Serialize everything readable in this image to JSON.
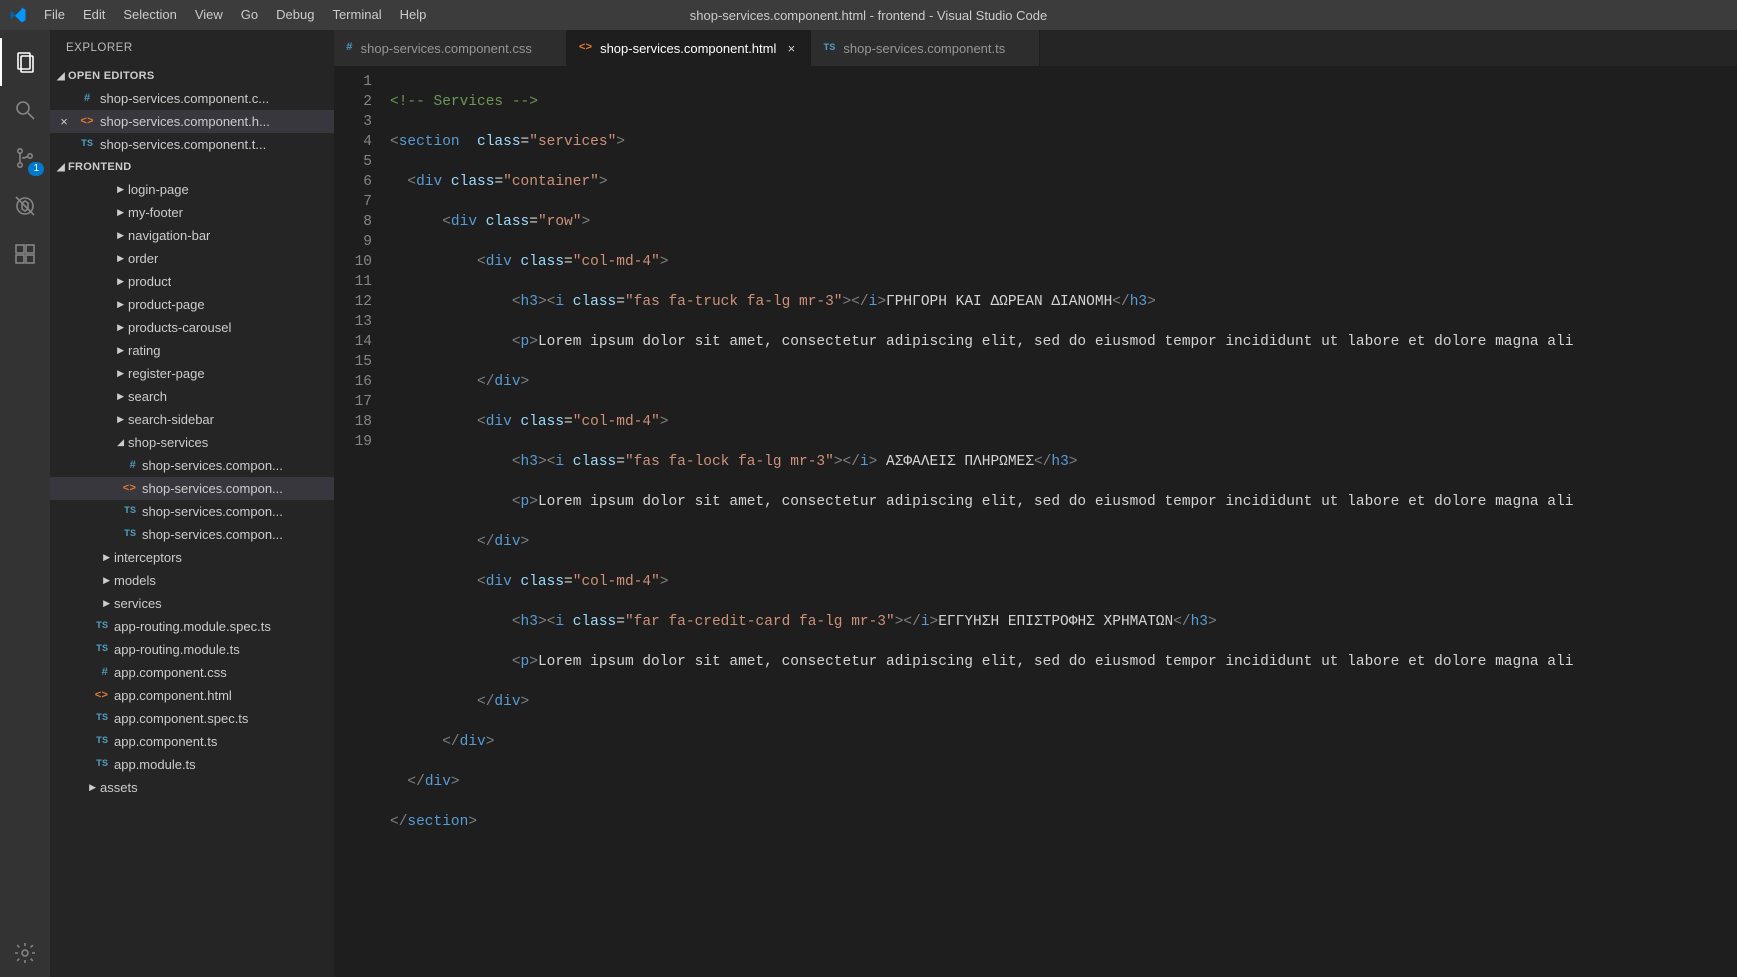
{
  "titlebar": {
    "title": "shop-services.component.html - frontend - Visual Studio Code",
    "menu": [
      "File",
      "Edit",
      "Selection",
      "View",
      "Go",
      "Debug",
      "Terminal",
      "Help"
    ]
  },
  "activitybar": {
    "scm_badge": "1"
  },
  "sidebar": {
    "title": "EXPLORER",
    "open_editors_label": "OPEN EDITORS",
    "open_editors": [
      {
        "name": "shop-services.component.c...",
        "icon": "css",
        "active": false,
        "close": " "
      },
      {
        "name": "shop-services.component.h...",
        "icon": "html",
        "active": true,
        "close": "×"
      },
      {
        "name": "shop-services.component.t...",
        "icon": "ts",
        "active": false,
        "close": " "
      }
    ],
    "workspace_label": "FRONTEND",
    "tree": [
      {
        "type": "folder",
        "depth": 3,
        "open": false,
        "name": "login-page"
      },
      {
        "type": "folder",
        "depth": 3,
        "open": false,
        "name": "my-footer"
      },
      {
        "type": "folder",
        "depth": 3,
        "open": false,
        "name": "navigation-bar"
      },
      {
        "type": "folder",
        "depth": 3,
        "open": false,
        "name": "order"
      },
      {
        "type": "folder",
        "depth": 3,
        "open": false,
        "name": "product"
      },
      {
        "type": "folder",
        "depth": 3,
        "open": false,
        "name": "product-page"
      },
      {
        "type": "folder",
        "depth": 3,
        "open": false,
        "name": "products-carousel"
      },
      {
        "type": "folder",
        "depth": 3,
        "open": false,
        "name": "rating"
      },
      {
        "type": "folder",
        "depth": 3,
        "open": false,
        "name": "register-page"
      },
      {
        "type": "folder",
        "depth": 3,
        "open": false,
        "name": "search"
      },
      {
        "type": "folder",
        "depth": 3,
        "open": false,
        "name": "search-sidebar"
      },
      {
        "type": "folder",
        "depth": 3,
        "open": true,
        "name": "shop-services"
      },
      {
        "type": "file",
        "depth": 4,
        "icon": "css",
        "name": "shop-services.compon..."
      },
      {
        "type": "file",
        "depth": 4,
        "icon": "html",
        "name": "shop-services.compon...",
        "selected": true
      },
      {
        "type": "file",
        "depth": 4,
        "icon": "ts",
        "name": "shop-services.compon..."
      },
      {
        "type": "file",
        "depth": 4,
        "icon": "ts",
        "name": "shop-services.compon..."
      },
      {
        "type": "folder",
        "depth": 2,
        "open": false,
        "name": "interceptors"
      },
      {
        "type": "folder",
        "depth": 2,
        "open": false,
        "name": "models"
      },
      {
        "type": "folder",
        "depth": 2,
        "open": false,
        "name": "services"
      },
      {
        "type": "file",
        "depth": 2,
        "icon": "ts",
        "name": "app-routing.module.spec.ts"
      },
      {
        "type": "file",
        "depth": 2,
        "icon": "ts",
        "name": "app-routing.module.ts"
      },
      {
        "type": "file",
        "depth": 2,
        "icon": "css",
        "name": "app.component.css"
      },
      {
        "type": "file",
        "depth": 2,
        "icon": "html",
        "name": "app.component.html"
      },
      {
        "type": "file",
        "depth": 2,
        "icon": "ts",
        "name": "app.component.spec.ts"
      },
      {
        "type": "file",
        "depth": 2,
        "icon": "ts",
        "name": "app.component.ts"
      },
      {
        "type": "file",
        "depth": 2,
        "icon": "ts",
        "name": "app.module.ts"
      },
      {
        "type": "folder",
        "depth": 1,
        "open": false,
        "name": "assets"
      }
    ]
  },
  "tabs": [
    {
      "name": "shop-services.component.css",
      "icon": "css",
      "active": false
    },
    {
      "name": "shop-services.component.html",
      "icon": "html",
      "active": true
    },
    {
      "name": "shop-services.component.ts",
      "icon": "ts",
      "active": false
    }
  ],
  "code": {
    "line_numbers": [
      "1",
      "2",
      "3",
      "4",
      "5",
      "6",
      "7",
      "8",
      "9",
      "10",
      "11",
      "12",
      "13",
      "14",
      "15",
      "16",
      "17",
      "18",
      "19"
    ],
    "lines": {
      "l1": "<!-- Services -->",
      "l2_tag": "section",
      "l2_attr": "class",
      "l2_val": "\"services\"",
      "l3_tag": "div",
      "l3_attr": "class",
      "l3_val": "\"container\"",
      "l4_tag": "div",
      "l4_attr": "class",
      "l4_val": "\"row\"",
      "l5_tag": "div",
      "l5_attr": "class",
      "l5_val": "\"col-md-4\"",
      "l6_h3": "h3",
      "l6_i": "i",
      "l6_attr": "class",
      "l6_val": "\"fas fa-truck fa-lg mr-3\"",
      "l6_text": "ΓΡΗΓΟΡΗ ΚΑΙ ΔΩΡΕΑΝ ΔΙΑΝΟΜΗ",
      "l7_p": "p",
      "l7_text": "Lorem ipsum dolor sit amet, consectetur adipiscing elit, sed do eiusmod tempor incididunt ut labore et dolore magna ali",
      "l8_tag": "div",
      "l9_tag": "div",
      "l9_attr": "class",
      "l9_val": "\"col-md-4\"",
      "l10_h3": "h3",
      "l10_i": "i",
      "l10_attr": "class",
      "l10_val": "\"fas fa-lock fa-lg mr-3\"",
      "l10_text": " ΑΣΦΑΛΕΙΣ ΠΛΗΡΩΜΕΣ",
      "l11_p": "p",
      "l11_text": "Lorem ipsum dolor sit amet, consectetur adipiscing elit, sed do eiusmod tempor incididunt ut labore et dolore magna ali",
      "l12_tag": "div",
      "l13_tag": "div",
      "l13_attr": "class",
      "l13_val": "\"col-md-4\"",
      "l14_h3": "h3",
      "l14_i": "i",
      "l14_attr": "class",
      "l14_val": "\"far fa-credit-card fa-lg mr-3\"",
      "l14_text": "ΕΓΓΥΗΣΗ ΕΠΙΣΤΡΟΦΗΣ ΧΡΗΜΑΤΩΝ",
      "l15_p": "p",
      "l15_text": "Lorem ipsum dolor sit amet, consectetur adipiscing elit, sed do eiusmod tempor incididunt ut labore et dolore magna ali",
      "l16_tag": "div",
      "l17_tag": "div",
      "l18_tag": "div",
      "l19_tag": "section"
    }
  },
  "icons": {
    "css": "#",
    "html": "<>",
    "ts": "TS"
  }
}
